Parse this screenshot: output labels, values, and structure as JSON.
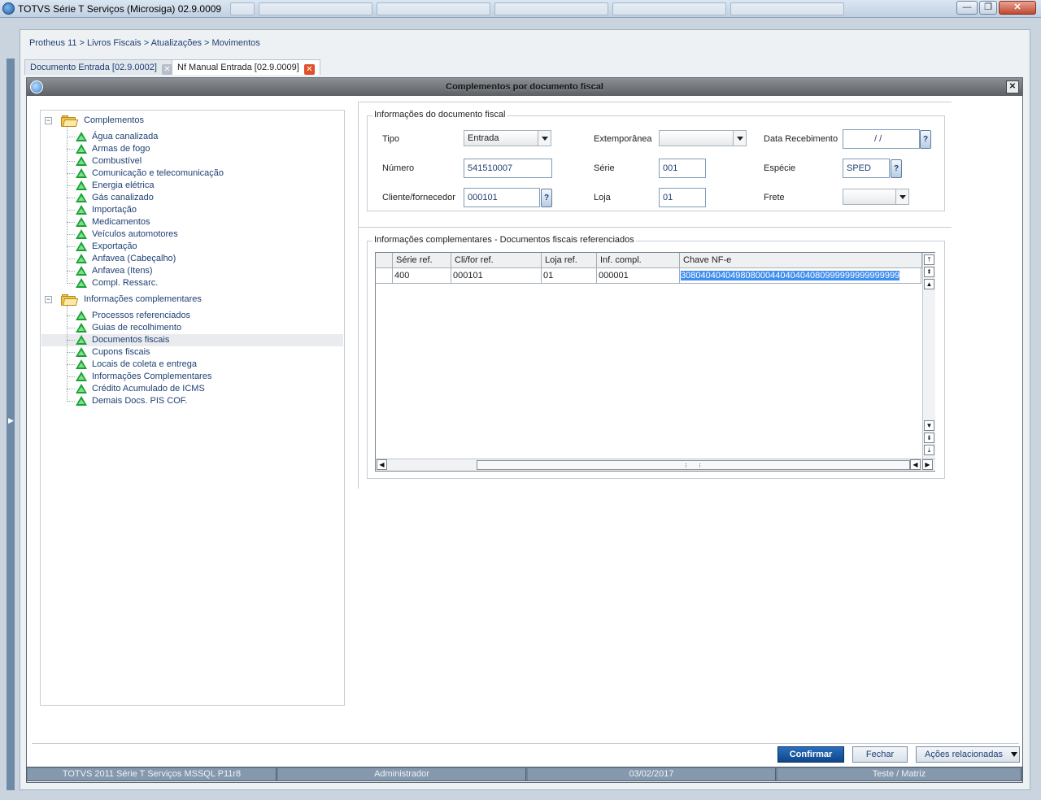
{
  "window": {
    "title": "TOTVS Série T Serviços (Microsiga) 02.9.0009",
    "min": "—",
    "restore": "❐",
    "close": "✕"
  },
  "breadcrumb": "Protheus 11 > Livros Fiscais > Atualizações > Movimentos",
  "tabs": [
    {
      "label": "Documento Entrada [02.9.0002]",
      "close": "✕"
    },
    {
      "label": "Nf Manual Entrada [02.9.0009]",
      "close": "✕"
    }
  ],
  "dialog": {
    "title": "Complementos por documento fiscal",
    "close": "✕"
  },
  "tree": {
    "groups": [
      {
        "label": "Complementos",
        "expander": "−",
        "items": [
          "Água canalizada",
          "Armas de fogo",
          "Combustível",
          "Comunicação e telecomunicação",
          "Energia elétrica",
          "Gás canalizado",
          "Importação",
          "Medicamentos",
          "Veículos automotores",
          "Exportação",
          "Anfavea (Cabeçalho)",
          "Anfavea (Itens)",
          "Compl. Ressarc."
        ]
      },
      {
        "label": "Informações complementares",
        "expander": "−",
        "items": [
          "Processos referenciados",
          "Guias de recolhimento",
          "Documentos fiscais",
          "Cupons fiscais",
          "Locais de coleta e entrega",
          "Informações Complementares",
          "Crédito Acumulado de ICMS",
          "Demais Docs. PIS COF."
        ],
        "selected_index": 2
      }
    ]
  },
  "doc_info": {
    "title": "Informações do documento fiscal",
    "tipo_label": "Tipo",
    "tipo_value": "Entrada",
    "extemporanea_label": "Extemporânea",
    "extemporanea_value": "",
    "data_recebimento_label": "Data Recebimento",
    "data_recebimento_value": "/ /",
    "numero_label": "Número",
    "numero_value": "541510007",
    "serie_label": "Série",
    "serie_value": "001",
    "especie_label": "Espécie",
    "especie_value": "SPED",
    "cliente_label": "Cliente/fornecedor",
    "cliente_value": "000101",
    "loja_label": "Loja",
    "loja_value": "01",
    "frete_label": "Frete",
    "frete_value": "",
    "lookup": "?"
  },
  "refs": {
    "title": "Informações complementares - Documentos fiscais referenciados",
    "columns": [
      "",
      "Série ref.",
      "Cli/for ref.",
      "Loja ref.",
      "Inf. compl.",
      "Chave NF-e"
    ],
    "rows": [
      [
        "",
        "400",
        "000101",
        "01",
        "000001",
        "30804040404980800044040404080999999999999999"
      ]
    ],
    "scroll": {
      "top": "⤒",
      "pgup": "⇞",
      "up": "▲",
      "down": "▼",
      "pgdn": "⇟",
      "bottom": "⤓",
      "left": "◀",
      "left2": "◀",
      "right": "▶"
    }
  },
  "footer": {
    "confirm": "Confirmar",
    "close": "Fechar",
    "actions": "Ações relacionadas"
  },
  "status": {
    "product": "TOTVS 2011 Série T Serviços MSSQL P11r8",
    "user": "Administrador",
    "date": "03/02/2017",
    "branch": "Teste / Matriz"
  }
}
